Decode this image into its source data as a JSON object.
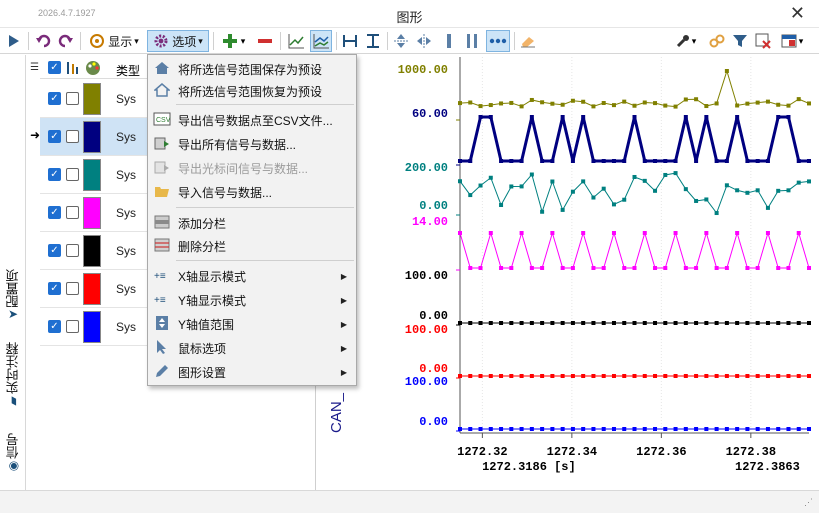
{
  "window": {
    "version": "2026.4.7.1927",
    "title": "图形",
    "close_glyph": "✕"
  },
  "toolbar": {
    "display_label": "显示",
    "options_label": "选项",
    "dropdown_glyph": "▾"
  },
  "sidebar": {
    "tabs": [
      {
        "label": "信号",
        "icon": "signal-icon"
      },
      {
        "label": "实时注释",
        "icon": "annotation-icon"
      },
      {
        "label": "配置项",
        "icon": "config-icon"
      }
    ]
  },
  "signal_grid": {
    "header_type": "类型",
    "rows": [
      {
        "type": "Sys",
        "color": "#808000",
        "checked": true,
        "selected": false
      },
      {
        "type": "Sys",
        "color": "#000080",
        "checked": true,
        "selected": true
      },
      {
        "type": "Sys",
        "color": "#008080",
        "checked": true,
        "selected": false
      },
      {
        "type": "Sys",
        "color": "#ff00ff",
        "checked": true,
        "selected": false
      },
      {
        "type": "Sys",
        "color": "#000000",
        "checked": true,
        "selected": false
      },
      {
        "type": "Sys",
        "color": "#ff0000",
        "checked": true,
        "selected": false
      },
      {
        "type": "Sys",
        "color": "#0000ff",
        "checked": true,
        "selected": false
      }
    ]
  },
  "menu": {
    "items": [
      {
        "label": "将所选信号范围保存为预设",
        "icon": "home-save-icon",
        "disabled": false,
        "submenu": false
      },
      {
        "label": "将所选信号范围恢复为预设",
        "icon": "home-restore-icon",
        "disabled": false,
        "submenu": false
      },
      {
        "label": "导出信号数据点至CSV文件...",
        "icon": "csv-icon",
        "disabled": false,
        "submenu": false
      },
      {
        "label": "导出所有信号与数据...",
        "icon": "export-icon",
        "disabled": false,
        "submenu": false
      },
      {
        "label": "导出光标间信号与数据...",
        "icon": "export-cursor-icon",
        "disabled": true,
        "submenu": false
      },
      {
        "label": "导入信号与数据...",
        "icon": "folder-open-icon",
        "disabled": false,
        "submenu": false
      },
      {
        "label": "添加分栏",
        "icon": "add-column-icon",
        "disabled": false,
        "submenu": false
      },
      {
        "label": "删除分栏",
        "icon": "delete-column-icon",
        "disabled": false,
        "submenu": false
      },
      {
        "label": "X轴显示模式",
        "icon": "x-axis-icon",
        "disabled": false,
        "submenu": true
      },
      {
        "label": "Y轴显示模式",
        "icon": "y-axis-icon",
        "disabled": false,
        "submenu": true
      },
      {
        "label": "Y轴值范围",
        "icon": "y-range-icon",
        "disabled": false,
        "submenu": true
      },
      {
        "label": "鼠标选项",
        "icon": "cursor-icon",
        "disabled": false,
        "submenu": true
      },
      {
        "label": "图形设置",
        "icon": "pencil-icon",
        "disabled": false,
        "submenu": true
      }
    ],
    "submenu_glyph": "▶"
  },
  "chart": {
    "can_label": "CAN_",
    "cursor1_time": "1272.3186 [s]",
    "cursor2_time": "1272.3863",
    "x_ticks": [
      "1272.32",
      "1272.34",
      "1272.36",
      "1272.38"
    ],
    "x_tick_values": [
      1272.32,
      1272.34,
      1272.36,
      1272.38
    ],
    "x_range": [
      1272.315,
      1272.393
    ],
    "signals": [
      {
        "color": "#808000",
        "axis_top": "1000.00",
        "axis_bottom": ""
      },
      {
        "color": "#000080",
        "axis_top": "60.00",
        "axis_bottom": ""
      },
      {
        "color": "#008080",
        "axis_top": "200.00",
        "axis_bottom": "0.00"
      },
      {
        "color": "#ff00ff",
        "axis_top": "14.00",
        "axis_bottom": ""
      },
      {
        "color": "#000000",
        "axis_top": "100.00",
        "axis_bottom": "0.00"
      },
      {
        "color": "#ff0000",
        "axis_top": "100.00",
        "axis_bottom": "0.00"
      },
      {
        "color": "#0000ff",
        "axis_top": "100.00",
        "axis_bottom": "0.00"
      }
    ]
  }
}
